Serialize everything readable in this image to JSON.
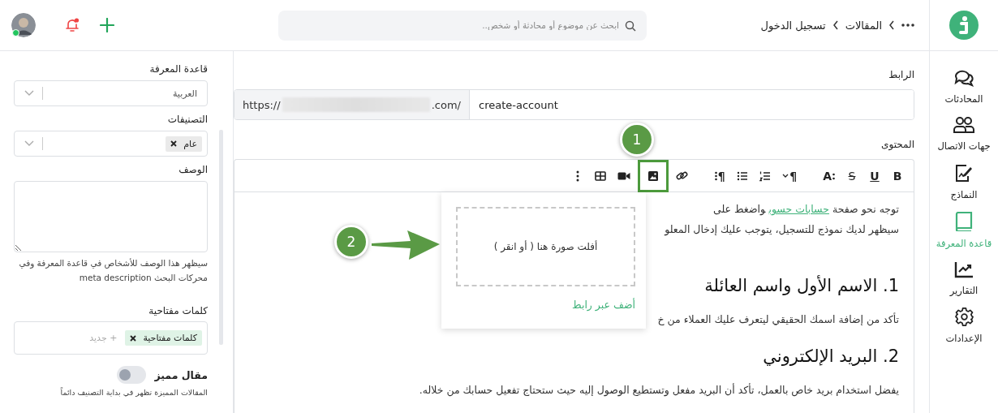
{
  "topbar": {
    "user": {
      "online": true
    },
    "notifications": {
      "unread": true
    },
    "search": {
      "placeholder": "ابحث عن موضوع أو محادثة أو شخص.."
    },
    "breadcrumb": [
      "المقالات",
      "تسجيل الدخول"
    ]
  },
  "nav": [
    {
      "kind": "chat",
      "label": "المحادثات",
      "selected": false
    },
    {
      "kind": "contacts",
      "label": "جهات الاتصال",
      "selected": false
    },
    {
      "kind": "templates",
      "label": "النماذج",
      "selected": false
    },
    {
      "kind": "book",
      "label": "قاعدة المعرفة",
      "selected": true
    },
    {
      "kind": "reports",
      "label": "التقارير",
      "selected": false
    },
    {
      "kind": "settings",
      "label": "الإعدادات",
      "selected": false
    }
  ],
  "settings_panel": {
    "knowledge_base": {
      "label": "قاعدة المعرفة",
      "value": "العربية"
    },
    "categories": {
      "label": "التصنيفات",
      "tags": [
        "عام"
      ]
    },
    "description": {
      "label": "الوصف",
      "help": "سيظهر هذا الوصف للأشخاص في قاعدة المعرفة وفي محركات البحث meta description"
    },
    "keywords": {
      "label": "كلمات مفتاحية",
      "tags": [
        "كلمات مفتاحية"
      ],
      "placeholder": "+ جديد"
    },
    "featured": {
      "label": "مقال مميز",
      "on": false,
      "help": "المقالات المميزة تظهر في بداية التصنيف دائماً"
    }
  },
  "url": {
    "label": "الرابط",
    "prefix_start": "https://",
    "prefix_end": ".com/",
    "value": "create-account"
  },
  "content": {
    "label": "المحتوى",
    "toolbar": [
      [
        {
          "kind": "bold",
          "glyph": "B",
          "highlighted": false
        },
        {
          "kind": "underline",
          "glyph": "U",
          "highlighted": false
        },
        {
          "kind": "strike",
          "glyph": "S",
          "highlighted": false
        },
        {
          "kind": "font",
          "glyph": "A",
          "highlighted": false
        }
      ],
      [
        {
          "kind": "paragraph",
          "glyph": "¶",
          "highlighted": false
        },
        {
          "kind": "ordered-list",
          "highlighted": false
        },
        {
          "kind": "bullet-list",
          "highlighted": false
        },
        {
          "kind": "align",
          "glyph": "¶",
          "highlighted": false
        }
      ],
      [
        {
          "kind": "link",
          "highlighted": false
        },
        {
          "kind": "image",
          "highlighted": true
        },
        {
          "kind": "video",
          "highlighted": false
        },
        {
          "kind": "table",
          "highlighted": false
        },
        {
          "kind": "more",
          "highlighted": false
        }
      ]
    ],
    "blocks": [
      {
        "kind": "paragraph",
        "text": "توجه نحو صفحة",
        "link": "حسابات حسوب",
        "text_after": "واضغط على"
      },
      {
        "kind": "paragraph",
        "text": "سيظهر لديك نموذج للتسجيل، يتوجب عليك إدخال المعلو"
      },
      {
        "kind": "heading",
        "text": "1. الاسم الأول واسم العائلة"
      },
      {
        "kind": "paragraph",
        "text": "تأكد من إضافة اسمك الحقيقي ليتعرف عليك العملاء من خ"
      },
      {
        "kind": "heading",
        "text": "2. البريد الإلكتروني"
      },
      {
        "kind": "paragraph",
        "text": "يفضل استخدام بريد خاص بالعمل، تأكد أن البريد مفعل وتستطيع الوصول إليه حيث ستحتاج تفعيل حسابك من خلاله."
      }
    ],
    "image_popup": {
      "drop_text": "أفلت صورة هنا ( أو انقر )",
      "link": "أضف عبر رابط"
    }
  },
  "annotations": [
    {
      "number": "1"
    },
    {
      "number": "2"
    }
  ]
}
